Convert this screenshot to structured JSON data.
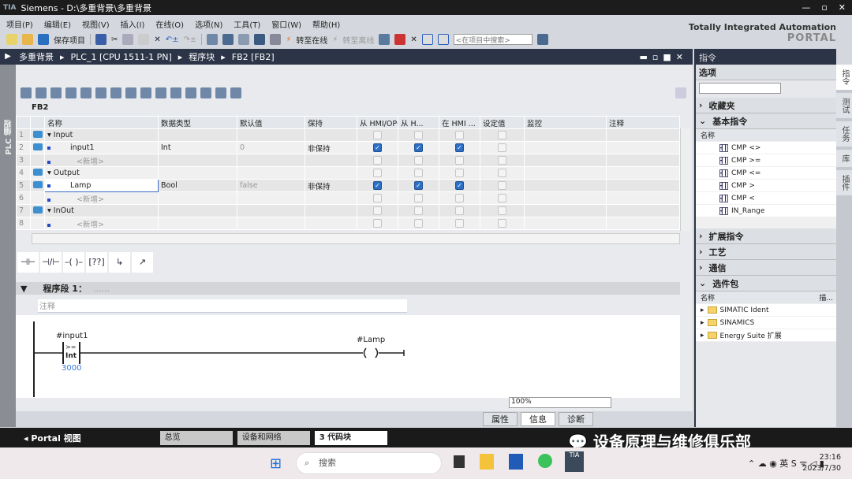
{
  "titlebar": {
    "app": "Siemens",
    "title": "Siemens  -  D:\\多重背景\\多重背景"
  },
  "menu": [
    "项目(P)",
    "编辑(E)",
    "视图(V)",
    "插入(I)",
    "在线(O)",
    "选项(N)",
    "工具(T)",
    "窗口(W)",
    "帮助(H)"
  ],
  "toolbar": {
    "save": "保存项目",
    "go_online": "转至在线",
    "go_offline": "转至离线",
    "search_placeholder": "<在项目中搜索>"
  },
  "brand": {
    "line1": "Totally Integrated Automation",
    "line2": "PORTAL"
  },
  "breadcrumb": [
    "多重背景",
    "PLC_1 [CPU 1511-1 PN]",
    "程序块",
    "FB2 [FB2]"
  ],
  "left_strip": "PLC 编程",
  "block_name": "FB2",
  "table": {
    "headers": [
      "名称",
      "数据类型",
      "默认值",
      "保持",
      "从 HMI/OPC...",
      "从 H...",
      "在 HMI ...",
      "设定值",
      "监控",
      "注释"
    ],
    "rows": [
      {
        "n": "1",
        "name": "Input",
        "type": "",
        "default": "",
        "retain": "",
        "c": [
          false,
          false,
          false,
          false
        ]
      },
      {
        "n": "2",
        "name": "input1",
        "type": "Int",
        "default": "0",
        "retain": "非保持",
        "c": [
          true,
          true,
          true,
          false
        ]
      },
      {
        "n": "3",
        "name": "<新增>",
        "type": "",
        "default": "",
        "retain": "",
        "c": [
          false,
          false,
          false,
          false
        ]
      },
      {
        "n": "4",
        "name": "Output",
        "type": "",
        "default": "",
        "retain": "",
        "c": [
          false,
          false,
          false,
          false
        ]
      },
      {
        "n": "5",
        "name": "Lamp",
        "type": "Bool",
        "default": "false",
        "retain": "非保持",
        "c": [
          true,
          true,
          true,
          false
        ]
      },
      {
        "n": "6",
        "name": "<新增>",
        "type": "",
        "default": "",
        "retain": "",
        "c": [
          false,
          false,
          false,
          false
        ]
      },
      {
        "n": "7",
        "name": "InOut",
        "type": "",
        "default": "",
        "retain": "",
        "c": [
          false,
          false,
          false,
          false
        ]
      },
      {
        "n": "8",
        "name": "<新增>",
        "type": "",
        "default": "",
        "retain": "",
        "c": [
          false,
          false,
          false,
          false
        ]
      }
    ]
  },
  "network": {
    "title": "程序段 1：",
    "dots": "......",
    "comment": "注释",
    "operand_in": "#input1",
    "cmp": ">=",
    "cmp_type": "Int",
    "operand2": "3000",
    "coil": "#Lamp"
  },
  "zoom": "100%",
  "inspector": [
    "属性",
    "信息",
    "诊断"
  ],
  "instructions": {
    "title": "指令",
    "options": "选项",
    "favorites": "收藏夹",
    "basic": "基本指令",
    "col_name": "名称",
    "items": [
      "CMP <>",
      "CMP >=",
      "CMP <=",
      "CMP >",
      "CMP <",
      "IN_Range"
    ],
    "extended": "扩展指令",
    "tech": "工艺",
    "comm": "通信",
    "optional": "选件包",
    "col_desc": "描...",
    "packages": [
      "SIMATIC Ident",
      "SINAMICS",
      "Energy Suite 扩展"
    ]
  },
  "right_tabs": [
    "指令",
    "测试",
    "任务",
    "库",
    "插件"
  ],
  "portal": {
    "back": "Portal 视图",
    "tabs": [
      "总览",
      "设备和网络",
      "3 代码块"
    ]
  },
  "watermark": "设备原理与维修俱乐部",
  "taskbar": {
    "search": "搜索",
    "time": "23:16",
    "date": "2023/7/30"
  }
}
